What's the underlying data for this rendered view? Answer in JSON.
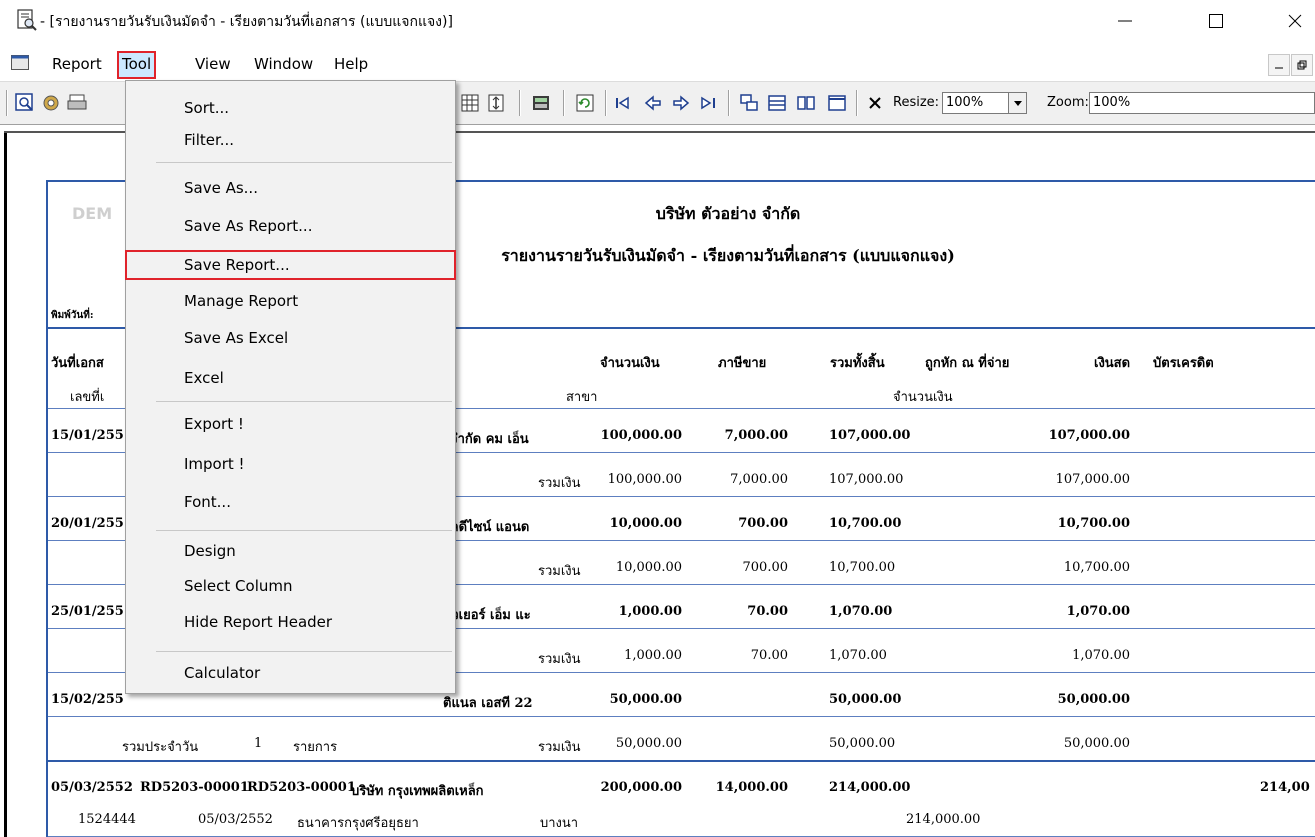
{
  "window": {
    "title": "- [รายงานรายวันรับเงินมัดจำ - เรียงตามวันที่เอกสาร (แบบแจกแจง)]"
  },
  "menubar": {
    "items": [
      "Report",
      "Tool",
      "View",
      "Window",
      "Help"
    ],
    "active": "Tool"
  },
  "toolbar": {
    "resize_label": "Resize:",
    "resize_value": "100%",
    "zoom_label": "Zoom:",
    "zoom_value": "100%"
  },
  "tool_menu": {
    "items": [
      {
        "label": "Sort...",
        "group": 0
      },
      {
        "label": "Filter...",
        "group": 0
      },
      {
        "label": "Save As...",
        "group": 1
      },
      {
        "label": "Save As Report...",
        "group": 1
      },
      {
        "label": "Save Report...",
        "group": 1,
        "highlighted": true
      },
      {
        "label": "Manage Report",
        "group": 1
      },
      {
        "label": "Save As Excel",
        "group": 1
      },
      {
        "label": "Excel",
        "group": 1
      },
      {
        "label": "Export !",
        "group": 2
      },
      {
        "label": "Import !",
        "group": 2
      },
      {
        "label": "Font...",
        "group": 2
      },
      {
        "label": "Design",
        "group": 3
      },
      {
        "label": "Select Column",
        "group": 3
      },
      {
        "label": "Hide Report Header",
        "group": 3
      },
      {
        "label": "Calculator",
        "group": 4
      }
    ]
  },
  "report": {
    "watermark": "DEM",
    "company": "บริษัท ตัวอย่าง จำกัด",
    "report_title": "รายงานรายวันรับเงินมัดจำ - เรียงตามวันที่เอกสาร (แบบแจกแจง)",
    "print_date_label": "พิมพ์วันที่: ",
    "header": {
      "doc_date": "วันที่เอกส",
      "doc_no": "เลขที่เ",
      "amount": "จำนวนเงิน",
      "tax": "ภาษีขาย",
      "total": "รวมทั้งสิ้น",
      "withheld": "ถูกหัก ณ ที่จ่าย",
      "cash": "เงินสด",
      "credit_card": "บัตรเครดิต",
      "branch": "สาขา",
      "amount2": "จำนวนเงิน"
    },
    "rows": [
      {
        "date": "15/01/255",
        "customer": "ะจำกัด คม เอ็น",
        "amount": "100,000.00",
        "tax": "7,000.00",
        "total": "107,000.00",
        "cash": "107,000.00"
      },
      {
        "subtotal": "รวมเงิน",
        "amount": "100,000.00",
        "tax": "7,000.00",
        "total": "107,000.00",
        "cash": "107,000.00"
      },
      {
        "date": "20/01/255",
        "customer": "ยลดีไซน์ แอนด",
        "amount": "10,000.00",
        "tax": "700.00",
        "total": "10,700.00",
        "cash": "10,700.00"
      },
      {
        "subtotal": "รวมเงิน",
        "amount": "10,000.00",
        "tax": "700.00",
        "total": "10,700.00",
        "cash": "10,700.00"
      },
      {
        "date": "25/01/255",
        "customer": "แวเยอร์ เอ็ม แะ",
        "amount": "1,000.00",
        "tax": "70.00",
        "total": "1,070.00",
        "cash": "1,070.00"
      },
      {
        "subtotal": "รวมเงิน",
        "amount": "1,000.00",
        "tax": "70.00",
        "total": "1,070.00",
        "cash": "1,070.00"
      },
      {
        "date": "15/02/255",
        "customer": "ติแนล เอสที 22",
        "amount": "50,000.00",
        "tax": "",
        "total": "50,000.00",
        "cash": "50,000.00"
      },
      {
        "daily_label": "รวมประจำวัน",
        "count": "1",
        "count_unit": "รายการ",
        "subtotal": "รวมเงิน",
        "amount": "50,000.00",
        "tax": "",
        "total": "50,000.00",
        "cash": "50,000.00"
      }
    ],
    "last_row": {
      "date": "05/03/2552",
      "doc_no": "RD5203-00001",
      "ref_no": "RD5203-00001",
      "customer": "บริษัท กรุงเทพผลิตเหล็ก",
      "amount": "200,000.00",
      "tax": "14,000.00",
      "total": "214,000.00",
      "credit_card": "214,00"
    },
    "detail_row": {
      "cheque_no": "1524444",
      "cheque_date": "05/03/2552",
      "bank": "ธนาคารกรุงศรีอยุธยา",
      "branch": "บางนา",
      "amount": "214,000.00"
    }
  }
}
